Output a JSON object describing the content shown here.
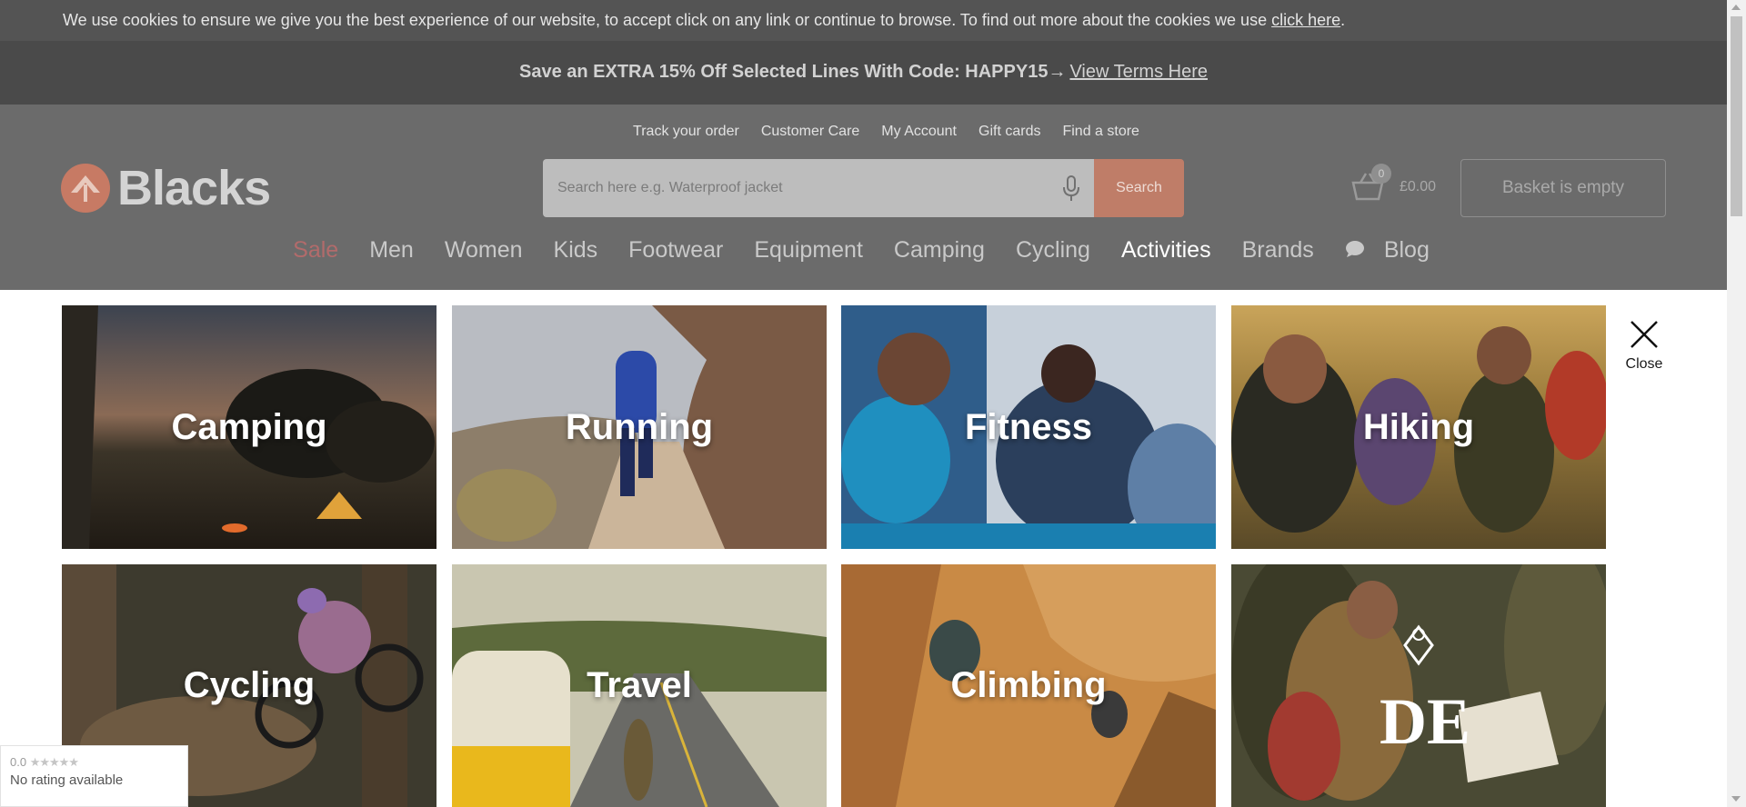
{
  "cookie_bar": {
    "text": "We use cookies to ensure we give you the best experience of our website, to accept click on any link or continue to browse. To find out more about the cookies we use ",
    "link": "click here",
    "end": "."
  },
  "promo": {
    "text": "Save an EXTRA 15% Off Selected Lines With Code: HAPPY15→",
    "link": "View Terms Here"
  },
  "util_links": [
    "Track your order",
    "Customer Care",
    "My Account",
    "Gift cards",
    "Find a store"
  ],
  "logo": {
    "text": "Blacks",
    "color": "#c77a64"
  },
  "search": {
    "placeholder": "Search here e.g. Waterproof jacket",
    "button": "Search",
    "icon": "microphone-icon"
  },
  "cart": {
    "count": "0",
    "total": "£0.00",
    "basket_label": "Basket is empty",
    "icon": "basket-icon"
  },
  "nav": [
    "Sale",
    "Men",
    "Women",
    "Kids",
    "Footwear",
    "Equipment",
    "Camping",
    "Cycling",
    "Activities",
    "Brands",
    "Blog"
  ],
  "nav_active": "Activities",
  "close": {
    "label": "Close",
    "icon": "close-icon"
  },
  "tiles": [
    {
      "label": "Camping"
    },
    {
      "label": "Running"
    },
    {
      "label": "Fitness"
    },
    {
      "label": "Hiking"
    },
    {
      "label": "Cycling"
    },
    {
      "label": "Travel"
    },
    {
      "label": "Climbing"
    },
    {
      "label": ""
    }
  ],
  "rating": {
    "score": "0.0",
    "stars": "★★★★★",
    "text": "No rating available"
  },
  "colors": {
    "accent": "#bf7d68",
    "sale": "#b26b6b",
    "header_bg": "#6b6b6b"
  }
}
